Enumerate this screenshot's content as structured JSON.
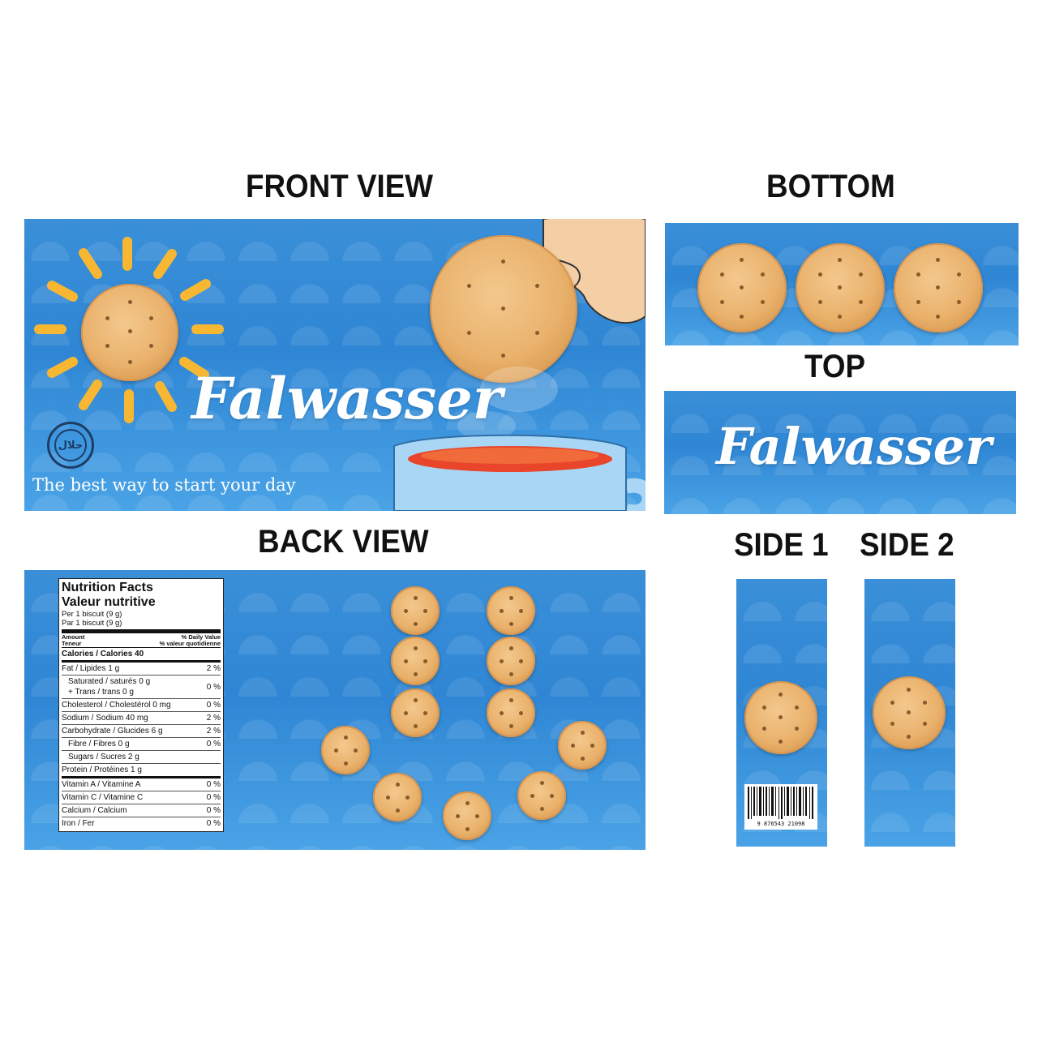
{
  "headings": {
    "front": "FRONT VIEW",
    "bottom": "BOTTOM",
    "top": "TOP",
    "back": "BACK VIEW",
    "side1": "SIDE 1",
    "side2": "SIDE 2"
  },
  "brand": "Falwasser",
  "tagline": "The best way to start your day",
  "nutrition": {
    "title_en": "Nutrition Facts",
    "title_fr": "Valeur nutritive",
    "serving_en": "Per 1 biscuit (9 g)",
    "serving_fr": "Par 1 biscuit (9 g)",
    "amount_en": "Amount",
    "amount_fr": "Teneur",
    "dv_en": "% Daily Value",
    "dv_fr": "% valeur quotidienne",
    "calories": "Calories / Calories 40",
    "rows": [
      {
        "label": "Fat / Lipides 1 g",
        "value": "2 %"
      },
      {
        "label": "Saturated / saturés 0 g",
        "label2": "+ Trans / trans 0 g",
        "value": "0 %"
      },
      {
        "label": "Cholesterol / Cholestérol 0 mg",
        "value": "0 %"
      },
      {
        "label": "Sodium / Sodium 40 mg",
        "value": "2 %"
      },
      {
        "label": "Carbohydrate / Glucides 6 g",
        "value": "2 %"
      },
      {
        "label": "Fibre / Fibres 0 g",
        "value": "0 %"
      },
      {
        "label": "Sugars / Sucres  2 g",
        "value": ""
      },
      {
        "label": "Protein / Protéines 1 g",
        "value": ""
      }
    ],
    "vitamins": [
      {
        "label": "Vitamin A / Vitamine A",
        "value": "0 %"
      },
      {
        "label": "Vitamin C / Vitamine C",
        "value": "0 %"
      },
      {
        "label": "Calcium / Calcium",
        "value": "0 %"
      },
      {
        "label": "Iron / Fer",
        "value": "0 %"
      }
    ]
  },
  "barcode_number": "9 876543 21098",
  "colors": {
    "panel_blue": "#3a8fd8",
    "sun_yellow": "#f7b733",
    "tea_red": "#e8452a",
    "cup_blue": "#a9d6f5"
  }
}
